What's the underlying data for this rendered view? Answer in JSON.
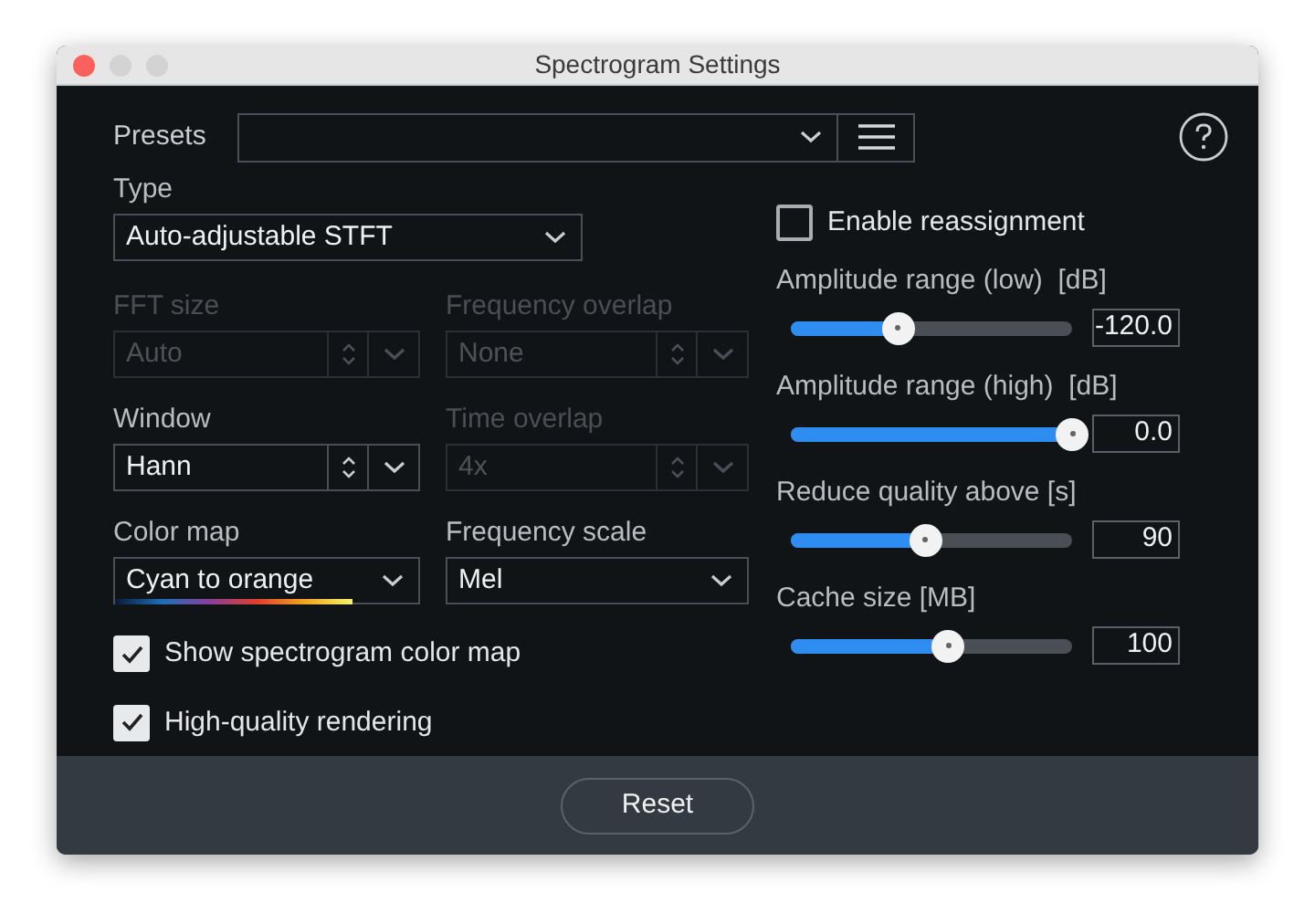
{
  "window": {
    "title": "Spectrogram Settings"
  },
  "presets": {
    "label": "Presets"
  },
  "type": {
    "label": "Type",
    "value": "Auto-adjustable STFT"
  },
  "fields": [
    {
      "label": "FFT size",
      "value": "Auto",
      "kind": "spinner",
      "disabled": true
    },
    {
      "label": "Frequency overlap",
      "value": "None",
      "kind": "spinner",
      "disabled": true
    },
    {
      "label": "Window",
      "value": "Hann",
      "kind": "spinner",
      "disabled": false
    },
    {
      "label": "Time overlap",
      "value": "4x",
      "kind": "spinner",
      "disabled": true
    },
    {
      "label": "Color map",
      "value": "Cyan to orange",
      "kind": "colormap",
      "disabled": false
    },
    {
      "label": "Frequency scale",
      "value": "Mel",
      "kind": "select",
      "disabled": false
    }
  ],
  "checkboxes": [
    {
      "label": "Show spectrogram color map",
      "checked": true
    },
    {
      "label": "High-quality rendering",
      "checked": true
    }
  ],
  "reassignment": {
    "label": "Enable reassignment",
    "checked": false
  },
  "sliders": [
    {
      "label": "Amplitude range (low)  [dB]",
      "level": 0.38,
      "reading": "-120.0"
    },
    {
      "label": "Amplitude range (high)  [dB]",
      "level": 1,
      "reading": "0.0"
    },
    {
      "label": "Reduce quality above [s]",
      "level": 0.48,
      "reading": "90"
    },
    {
      "label": "Cache size [MB]",
      "level": 0.56,
      "reading": "100"
    }
  ],
  "footer": {
    "button": "Reset"
  }
}
